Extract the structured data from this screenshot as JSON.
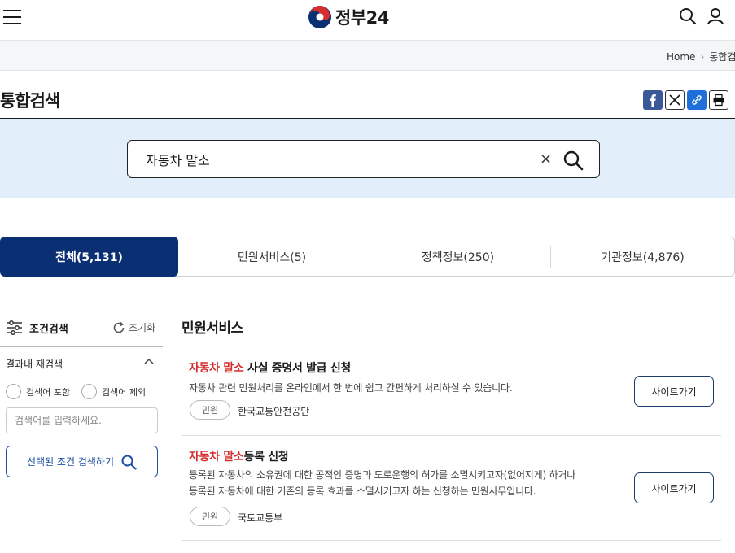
{
  "header": {
    "logo_text": "정부24",
    "menu_icon": "hamburger-menu-icon",
    "search_icon": "search-icon",
    "user_icon": "user-icon"
  },
  "breadcrumb": {
    "home": "Home",
    "current": "통합검색"
  },
  "page": {
    "title": "통합검색"
  },
  "share": {
    "facebook_icon": "facebook-icon",
    "x_icon": "x-twitter-icon",
    "link_icon": "link-icon",
    "print_icon": "print-icon"
  },
  "search": {
    "value": "자동차 말소",
    "clear": "×"
  },
  "tabs": [
    {
      "label": "전체(5,131)",
      "active": true
    },
    {
      "label": "민원서비스(5)",
      "active": false
    },
    {
      "label": "정책정보(250)",
      "active": false
    },
    {
      "label": "기관정보(4,876)",
      "active": false
    }
  ],
  "filter": {
    "title": "조건검색",
    "reset": "초기화",
    "refine_label": "결과내 재검색",
    "include": "검색어 포함",
    "exclude": "검색어 제외",
    "placeholder": "검색어를 입력하세요.",
    "apply": "선택된 조건 검색하기"
  },
  "results": {
    "section_title": "민원서비스",
    "items": [
      {
        "title_hl": "자동차 말소",
        "title_rest": " 사실 증명서 발급 신청",
        "desc1": "자동차 관련 민원처리를 온라인에서 한 번에 쉽고 간편하게 처리하실 수 있습니다.",
        "desc2": "",
        "badge": "민원",
        "org": "한국교통안전공단",
        "button": "사이트가기"
      },
      {
        "title_hl": "자동차 말소",
        "title_rest": "등록 신청",
        "desc1": "등록된 자동차의 소유권에 대한 공적인 증명과 도로운행의 허가를 소멸시키고자(없어지게) 하거나",
        "desc2": "등록된 자동차에 대한 기존의 등록 효과를 소멸시키고자 하는 신청하는 민원사무입니다.",
        "badge": "민원",
        "org": "국토교통부",
        "button": "사이트가기"
      }
    ]
  },
  "colors": {
    "primary_navy": "#0b2f73",
    "highlight_red": "#d32f2f",
    "search_band": "#e3eefb",
    "facebook_blue": "#3b5998",
    "link_blue": "#1e6fd9"
  }
}
